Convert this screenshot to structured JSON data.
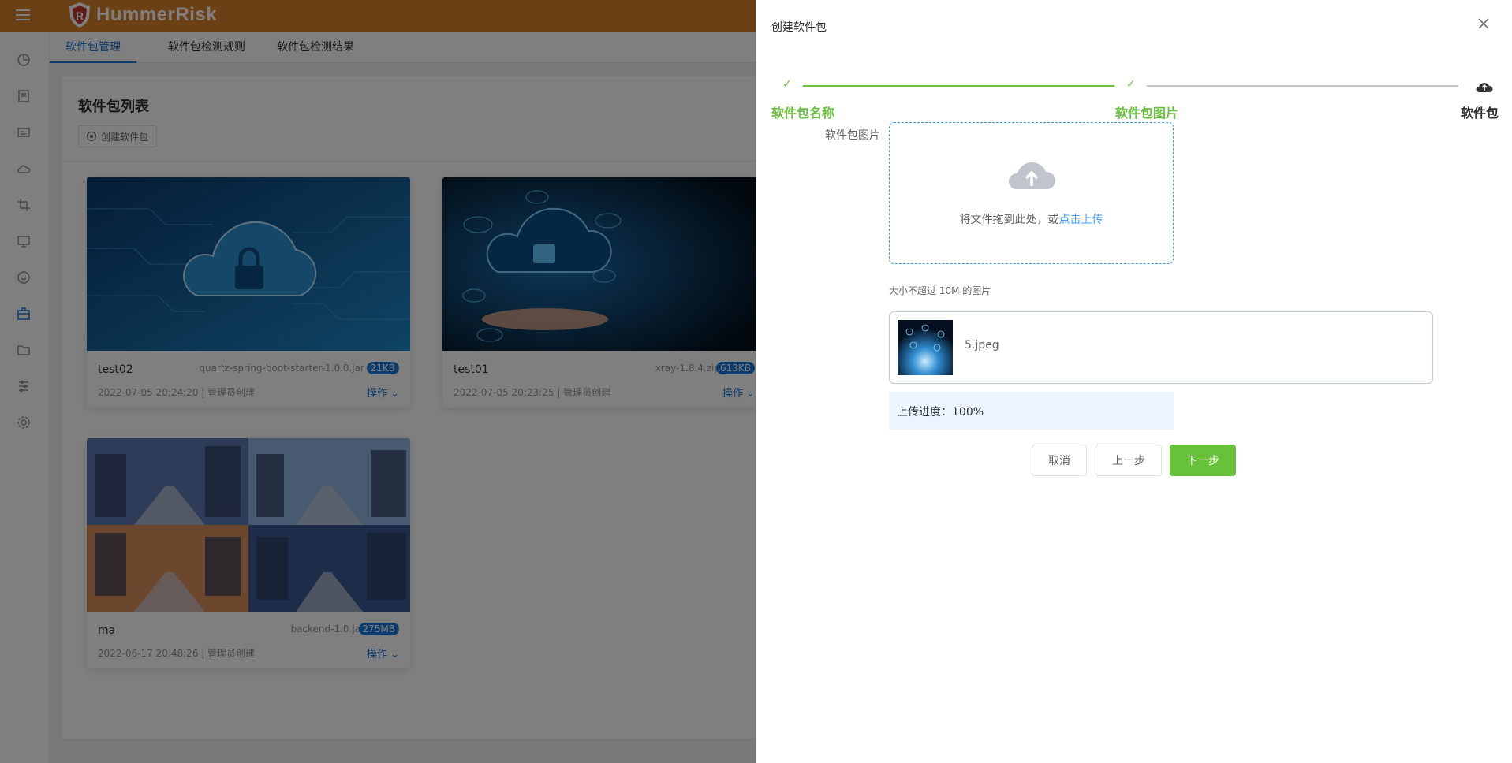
{
  "app": {
    "name": "HummerRisk"
  },
  "tabs": [
    "软件包管理",
    "软件包检测规则",
    "软件包检测结果"
  ],
  "main": {
    "title": "软件包列表",
    "create_label": "创建软件包"
  },
  "cards": [
    {
      "name": "test02",
      "file": "quartz-spring-boot-starter-1.0.0.jar",
      "size": "21KB",
      "meta": "2022-07-05 20:24:20 | 管理员创建",
      "op": "操作"
    },
    {
      "name": "test01",
      "file": "xray-1.8.4.zip",
      "size": "613KB",
      "meta": "2022-07-05 20:23:25 | 管理员创建",
      "op": "操作"
    },
    {
      "name": "ma",
      "file": "backend-1.0.jar",
      "size": "275MB",
      "meta": "2022-06-17 20:48:26 | 管理员创建",
      "op": "操作"
    }
  ],
  "drawer": {
    "title": "创建软件包",
    "steps": [
      {
        "label": "软件包名称",
        "status": "done"
      },
      {
        "label": "软件包图片",
        "status": "done"
      },
      {
        "label": "软件包",
        "status": "current"
      }
    ],
    "form_label": "软件包图片",
    "upload_text": "将文件拖到此处，或",
    "upload_link": "点击上传",
    "upload_tip": "大小不超过 10M 的图片",
    "file_name": "5.jpeg",
    "progress_text": "上传进度：100%",
    "progress": 1.0,
    "buttons": {
      "cancel": "取消",
      "prev": "上一步",
      "next": "下一步"
    }
  },
  "colors": {
    "header": "#d9812a",
    "accent": "#1a77d6",
    "success": "#67c23a",
    "link": "#409eff"
  }
}
